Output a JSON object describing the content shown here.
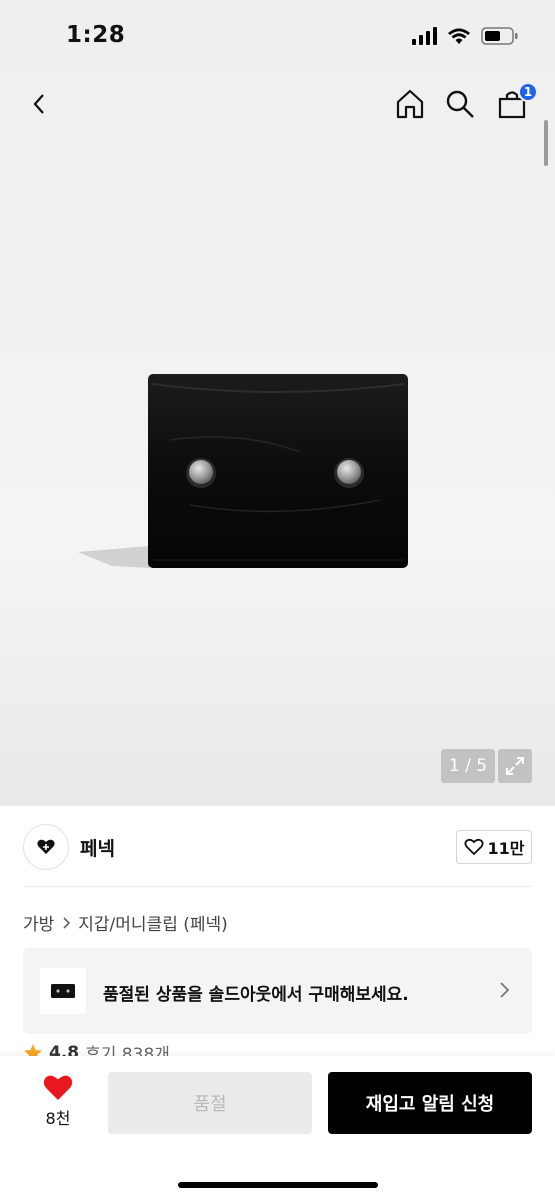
{
  "status_bar": {
    "time": "1:28"
  },
  "header": {
    "cart_badge": "1"
  },
  "gallery": {
    "counter": "1 / 5"
  },
  "brand": {
    "name": "페넥",
    "likes": "11만"
  },
  "breadcrumb": {
    "items": [
      "가방",
      "지갑/머니클립 (페넥)"
    ]
  },
  "soldout_banner": {
    "text": "품절된 상품을 솔드아웃에서 구매해보세요."
  },
  "rating": {
    "score": "4.8",
    "reviews": "후기 838개"
  },
  "bottom_bar": {
    "wish_count": "8천",
    "soldout_label": "품절",
    "restock_label": "재입고 알림 신청"
  },
  "colors": {
    "accent_badge": "#1e63e9",
    "heart": "#e8191e",
    "cta": "#000000",
    "star": "#f5a623"
  }
}
